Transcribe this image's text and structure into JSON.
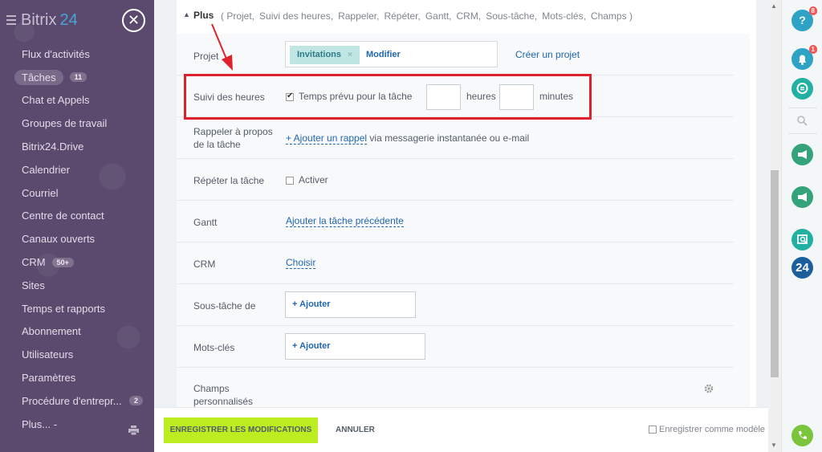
{
  "sidebar": {
    "logo_text": "Bitrix",
    "logo_num": "24",
    "close_symbol": "✕",
    "items": [
      {
        "label": "Flux d'activités"
      },
      {
        "label": "Tâches",
        "badge": "11"
      },
      {
        "label": "Chat et Appels"
      },
      {
        "label": "Groupes de travail"
      },
      {
        "label": "Bitrix24.Drive"
      },
      {
        "label": "Calendrier"
      },
      {
        "label": "Courriel"
      },
      {
        "label": "Centre de contact"
      },
      {
        "label": "Canaux ouverts"
      },
      {
        "label": "CRM",
        "badge": "50+"
      },
      {
        "label": "Sites"
      },
      {
        "label": "Temps et rapports"
      },
      {
        "label": "Abonnement"
      },
      {
        "label": "Utilisateurs"
      },
      {
        "label": "Paramètres"
      },
      {
        "label": "Procédure d'entrepr...",
        "badge": "2"
      },
      {
        "label": "Plus... -"
      }
    ]
  },
  "plus_section": {
    "title": "Plus",
    "items": [
      "( Projet,",
      "Suivi des heures,",
      "Rappeler,",
      "Répéter,",
      "Gantt,",
      "CRM,",
      "Sous-tâche,",
      "Mots-clés,",
      "Champs )"
    ]
  },
  "form": {
    "projet": {
      "label": "Projet",
      "tag": "Invitations",
      "tag_remove": "×",
      "modify": "Modifier",
      "create": "Créer un projet"
    },
    "suivi": {
      "label": "Suivi des heures",
      "checkbox_label": "Temps prévu pour la tâche",
      "hours_label": "heures",
      "minutes_label": "minutes",
      "hours_value": "",
      "minutes_value": ""
    },
    "rappel": {
      "label_line1": "Rappeler à propos",
      "label_line2": "de la tâche",
      "link": "+ Ajouter un rappel",
      "suffix": "via messagerie instantanée ou e-mail"
    },
    "repeter": {
      "label": "Répéter la tâche",
      "checkbox_label": "Activer"
    },
    "gantt": {
      "label": "Gantt",
      "link": "Ajouter la tâche précédente"
    },
    "crm": {
      "label": "CRM",
      "link": "Choisir"
    },
    "soustache": {
      "label": "Sous-tâche de",
      "button": "+ Ajouter"
    },
    "motscles": {
      "label": "Mots-clés",
      "button": "+ Ajouter"
    },
    "champs": {
      "label_line1": "Champs",
      "label_line2": "personnalisés"
    }
  },
  "footer": {
    "save": "ENREGISTRER LES MODIFICATIONS",
    "cancel": "ANNULER",
    "template_label": "Enregistrer comme modèle"
  },
  "rightbar": {
    "help_label": "?",
    "help_badge": "8",
    "notif_badge": "1",
    "bitrix_label": "24"
  },
  "colors": {
    "sidebar_bg": "#5b4a6e",
    "save_btn": "#bbed21",
    "highlight": "#e0202a",
    "link": "#2067b0"
  }
}
